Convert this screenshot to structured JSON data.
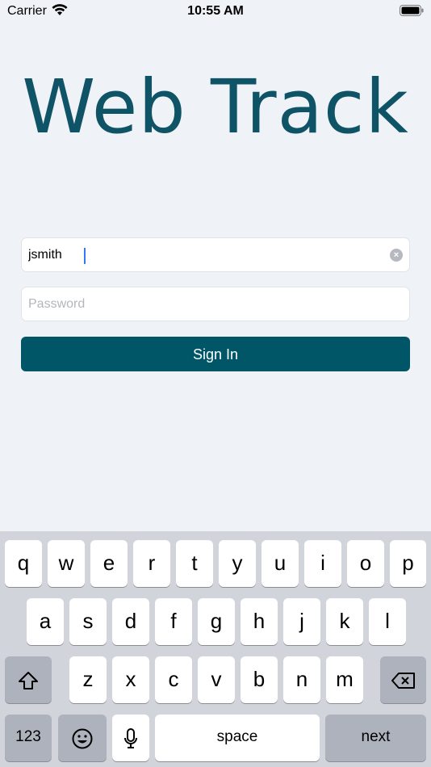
{
  "status_bar": {
    "carrier": "Carrier",
    "time": "10:55 AM"
  },
  "app": {
    "title": "Web Track"
  },
  "login": {
    "username_value": "jsmith",
    "password_placeholder": "Password",
    "sign_in_label": "Sign In",
    "clear_icon": "×"
  },
  "keyboard": {
    "row1": [
      "q",
      "w",
      "e",
      "r",
      "t",
      "y",
      "u",
      "i",
      "o",
      "p"
    ],
    "row2": [
      "a",
      "s",
      "d",
      "f",
      "g",
      "h",
      "j",
      "k",
      "l"
    ],
    "row3": [
      "z",
      "x",
      "c",
      "v",
      "b",
      "n",
      "m"
    ],
    "numbers_label": "123",
    "space_label": "space",
    "next_label": "next"
  }
}
